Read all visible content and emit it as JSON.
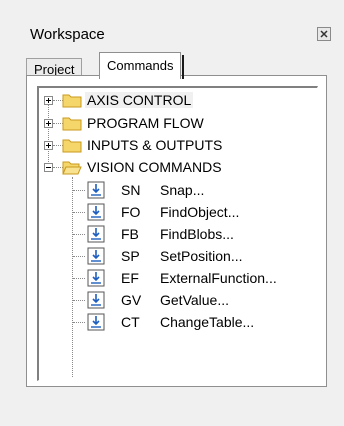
{
  "window": {
    "title": "Workspace"
  },
  "tabs": [
    {
      "label": "Project"
    },
    {
      "label": "Commands"
    }
  ],
  "tree": {
    "groups": [
      {
        "label": "AXIS CONTROL",
        "expanded": false
      },
      {
        "label": "PROGRAM FLOW",
        "expanded": false
      },
      {
        "label": "INPUTS & OUTPUTS",
        "expanded": false
      },
      {
        "label": "VISION COMMANDS",
        "expanded": true
      }
    ],
    "commands": [
      {
        "code": "SN",
        "name": "Snap..."
      },
      {
        "code": "FO",
        "name": "FindObject..."
      },
      {
        "code": "FB",
        "name": "FindBlobs..."
      },
      {
        "code": "SP",
        "name": "SetPosition..."
      },
      {
        "code": "EF",
        "name": "ExternalFunction..."
      },
      {
        "code": "GV",
        "name": "GetValue..."
      },
      {
        "code": "CT",
        "name": "ChangeTable..."
      }
    ]
  },
  "colors": {
    "folder": "#f5d66b",
    "folderDark": "#c99a1f",
    "icon": "#1f5fbf"
  }
}
